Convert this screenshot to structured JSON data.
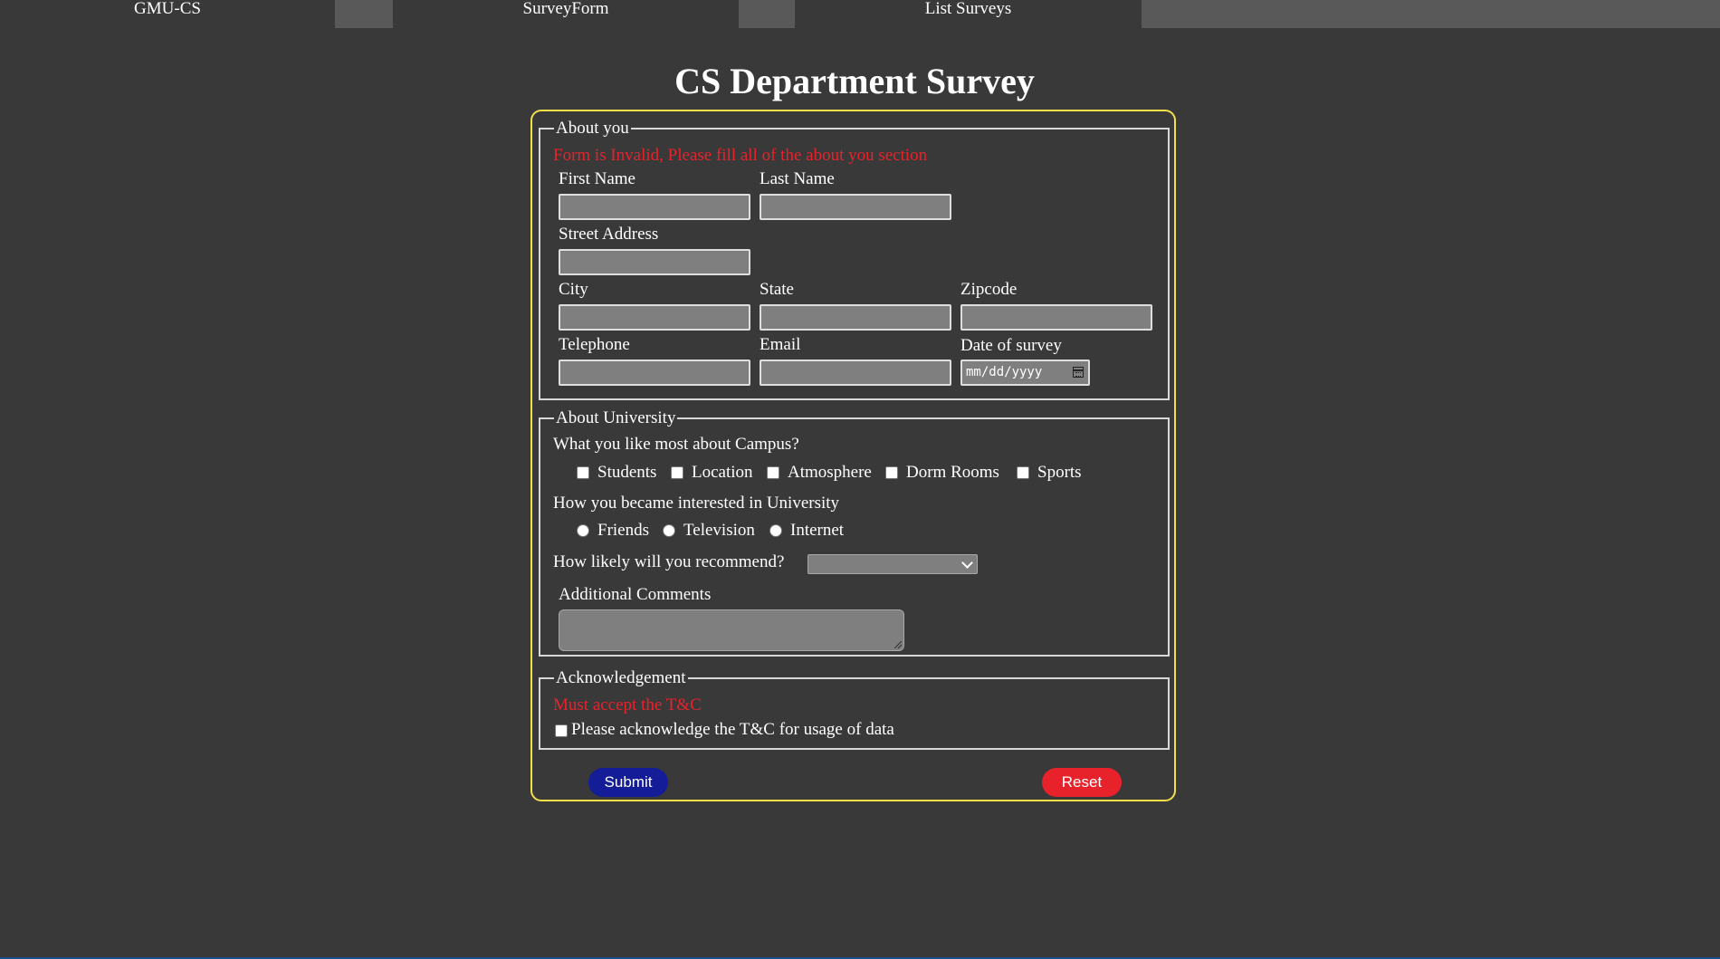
{
  "nav": {
    "brand": "GMU-CS",
    "survey_form": "SurveyForm",
    "list_surveys": "List Surveys"
  },
  "title": "CS Department Survey",
  "about_you": {
    "legend": "About you",
    "error": "Form is Invalid, Please fill all of the about you section",
    "first_name": "First Name",
    "last_name": "Last Name",
    "street_address": "Street Address",
    "city": "City",
    "state": "State",
    "zipcode": "Zipcode",
    "telephone": "Telephone",
    "email": "Email",
    "date_of_survey": "Date of survey",
    "date_placeholder": "mm/dd/yyyy",
    "date_icon": "calendar-icon"
  },
  "about_university": {
    "legend": "About University",
    "likes_question": "What you like most about Campus?",
    "likes_options": [
      "Students",
      "Location",
      "Atmosphere",
      "Dorm Rooms",
      "Sports"
    ],
    "interest_question": "How you became interested in University",
    "interest_options": [
      "Friends",
      "Television",
      "Internet"
    ],
    "recommend_question": "How likely will you recommend?",
    "recommend_selected": "",
    "comments_label": "Additional Comments"
  },
  "acknowledgement": {
    "legend": "Acknowledgement",
    "error": "Must accept the T&C",
    "checkbox_label": "Please acknowledge the T&C for usage of data"
  },
  "buttons": {
    "submit": "Submit",
    "reset": "Reset"
  },
  "colors": {
    "background": "#3a393a",
    "form_border": "#f3e04a",
    "error": "#e8222b",
    "submit": "#141d97",
    "reset": "#e8222b"
  }
}
